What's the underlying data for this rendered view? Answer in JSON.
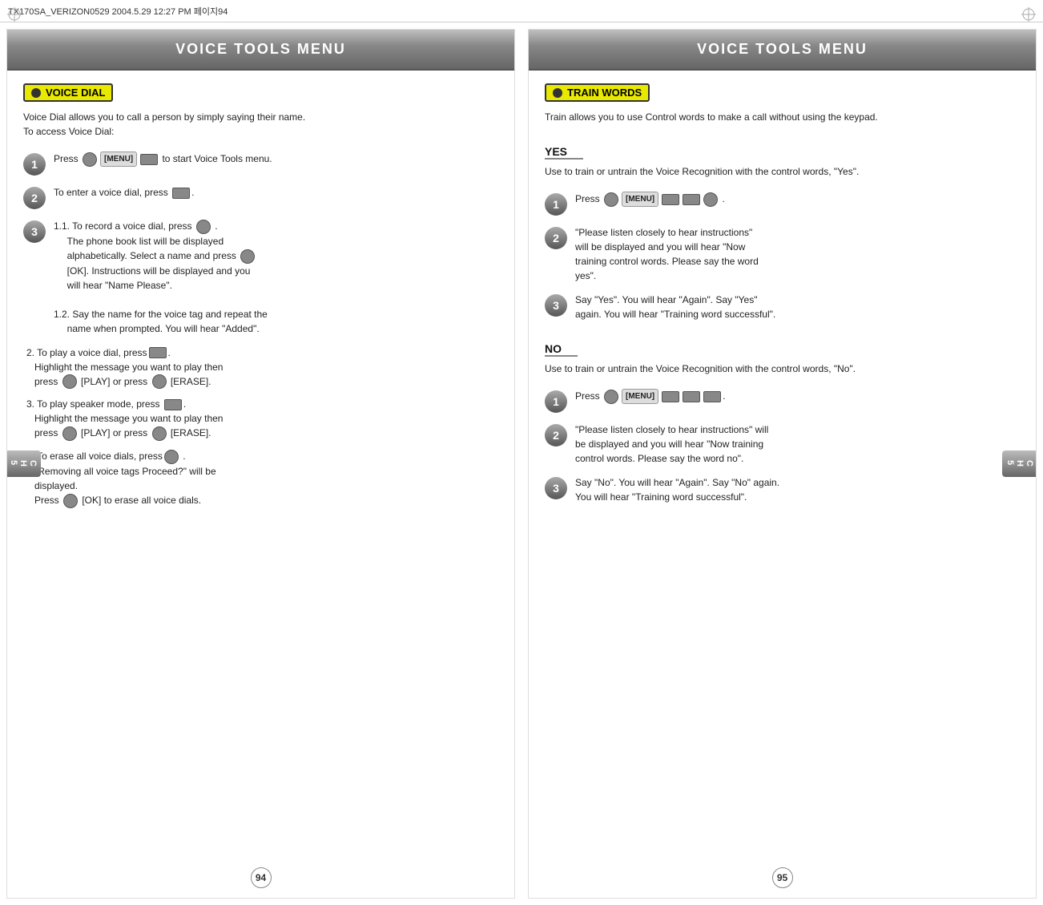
{
  "topbar": {
    "text": "TX170SA_VERIZON0529  2004.5.29 12:27 PM  페이지94"
  },
  "leftPanel": {
    "header": "VOICE TOOLS MENU",
    "sectionBadge": "VOICE DIAL",
    "description": "Voice Dial allows you to call a person by simply saying their name.\nTo access Voice Dial:",
    "steps": [
      {
        "num": "1",
        "text": "Press [MENU] to start Voice Tools menu."
      },
      {
        "num": "2",
        "text": "To enter a voice dial, press ."
      },
      {
        "num": "3",
        "text": "1.1. To record a voice dial, press .\n      The phone book list will be displayed alphabetically. Select a name and press [OK]. Instructions will be displayed and you will hear \"Name Please\".\n\n1.2. Say the name for the voice tag and repeat the name when prompted. You will hear \"Added\"."
      }
    ],
    "listItems": [
      "2. To play a voice dial, press .\n   Highlight the message you want to play then\n   press [PLAY] or press [ERASE].",
      "3. To play speaker mode, press .\n   Highlight the message you want to play then\n   press [PLAY] or press [ERASE].",
      "4. To erase all voice dials, press .\n   \"Removing all voice tags Proceed?\" will be displayed.\n   Press [OK] to erase all voice dials."
    ],
    "sideTab": "CH\n5",
    "pageNum": "94"
  },
  "rightPanel": {
    "header": "VOICE TOOLS MENU",
    "sectionBadge": "TRAIN WORDS",
    "description": "Train allows you to use Control words to make a call without using the keypad.",
    "subSections": [
      {
        "heading": "YES",
        "desc": "Use  to train or untrain the Voice Recognition with the control words, \"Yes\".",
        "steps": [
          {
            "num": "1",
            "text": "Press [MENU]  ."
          },
          {
            "num": "2",
            "text": "\"Please listen closely to hear instructions\" will be displayed and you will hear \"Now training control words.  Please say the word yes\"."
          },
          {
            "num": "3",
            "text": "Say \"Yes\". You will hear \"Again\". Say \"Yes\" again. You will hear \"Training word successful\"."
          }
        ]
      },
      {
        "heading": "NO",
        "desc": "Use  to train or untrain the Voice Recognition with the control words, \"No\".",
        "steps": [
          {
            "num": "1",
            "text": "Press [MENU]  ."
          },
          {
            "num": "2",
            "text": "\"Please listen closely to hear instructions\" will be displayed and you will hear \"Now training control words.  Please say the word no\"."
          },
          {
            "num": "3",
            "text": "Say \"No\". You will hear \"Again\". Say \"No\" again. You will hear \"Training word successful\"."
          }
        ]
      }
    ],
    "sideTab": "CH\n5",
    "pageNum": "95"
  }
}
